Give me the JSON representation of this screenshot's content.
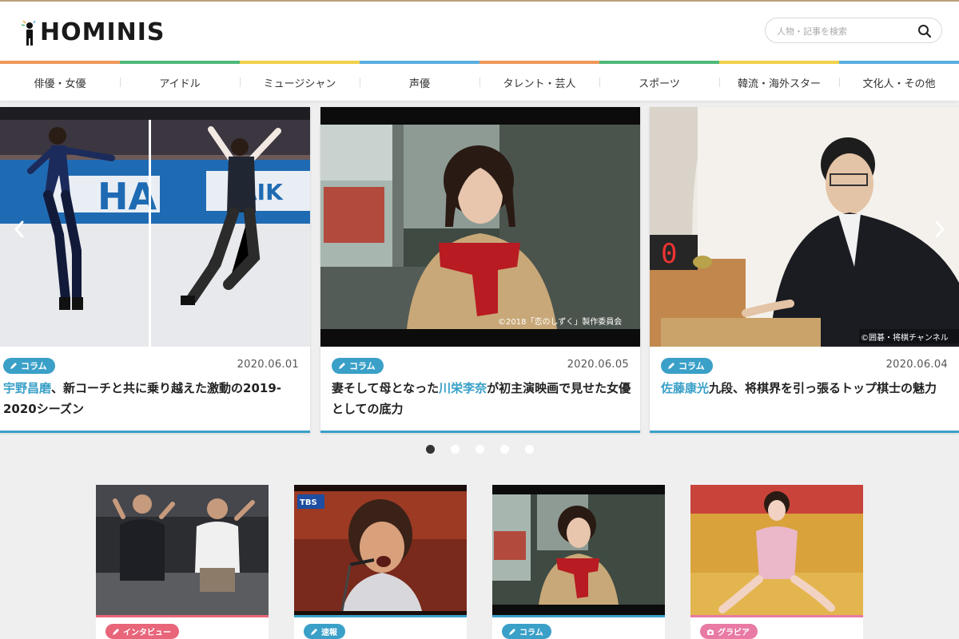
{
  "site": {
    "logo_text": "HOMINIS",
    "search_placeholder": "人物・記事を検索"
  },
  "nav": {
    "items": [
      {
        "label": "俳優・女優",
        "color": "#f0985a"
      },
      {
        "label": "アイドル",
        "color": "#4fb87a"
      },
      {
        "label": "ミュージシャン",
        "color": "#f2d04a"
      },
      {
        "label": "声優",
        "color": "#5aaee0"
      },
      {
        "label": "タレント・芸人",
        "color": "#f0985a"
      },
      {
        "label": "スポーツ",
        "color": "#4fb87a"
      },
      {
        "label": "韓流・海外スター",
        "color": "#f2d04a"
      },
      {
        "label": "文化人・その他",
        "color": "#5aaee0"
      }
    ]
  },
  "carousel": {
    "cards": [
      {
        "tag": "コラム",
        "date": "2020.06.01",
        "title_highlight": "宇野昌磨",
        "title_rest": "、新コーチと共に乗り越えた激動の2019-2020シーズン",
        "credit": ""
      },
      {
        "tag": "コラム",
        "date": "2020.06.05",
        "title_pre": "妻そして母となった",
        "title_highlight": "川栄李奈",
        "title_rest": "が初主演映画で見せた女優としての底力",
        "credit": "©2018「恋のしずく」製作委員会"
      },
      {
        "tag": "コラム",
        "date": "2020.06.04",
        "title_highlight": "佐藤康光",
        "title_rest": "九段、将棋界を引っ張るトップ棋士の魅力",
        "credit": "©囲碁・将棋チャンネル"
      }
    ],
    "dots": 5,
    "active_dot": 0
  },
  "grid": {
    "cards": [
      {
        "tag": "インタビュー",
        "tag_color": "#e8657a",
        "bar_color": "#e8657a"
      },
      {
        "tag": "速報",
        "tag_color": "#3aa0c8",
        "bar_color": "#3aa0c8"
      },
      {
        "tag": "コラム",
        "tag_color": "#3aa0c8",
        "bar_color": "#3aa0c8"
      },
      {
        "tag": "グラビア",
        "tag_color": "#e87aa5",
        "bar_color": "#e87aa5"
      }
    ],
    "badge_text": "TBS"
  },
  "colors": {
    "accent": "#3aa0c8"
  }
}
